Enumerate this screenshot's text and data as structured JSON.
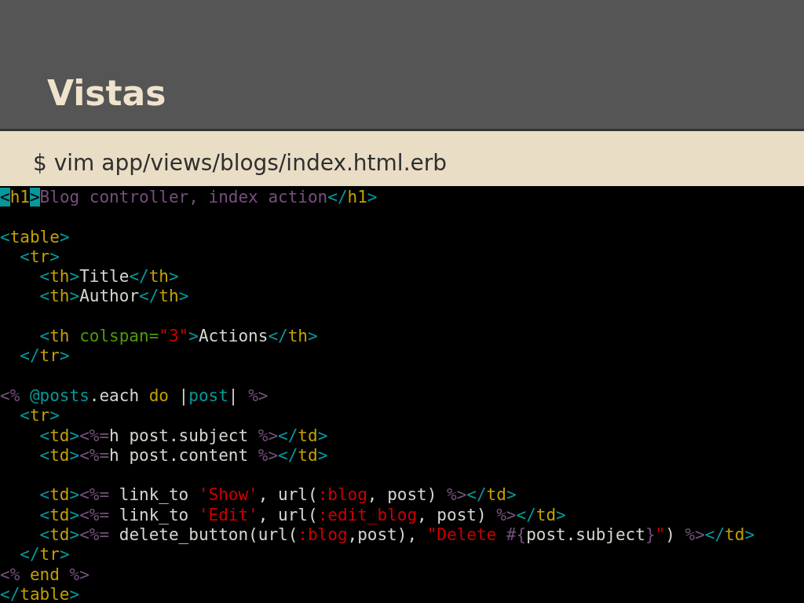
{
  "slide": {
    "title": "Vistas",
    "command": "$ vim app/views/blogs/index.html.erb"
  },
  "editor": {
    "lines": [
      {
        "kind": "code",
        "tokens": [
          {
            "t": "<",
            "color": "#06989a",
            "highlighted": true
          },
          {
            "t": "h1",
            "color": "#c4a000",
            "highlighted": false
          },
          {
            "t": ">",
            "color": "#06989a",
            "highlighted": true
          },
          {
            "t": "Blog controller, index action",
            "color": "#75507b",
            "highlighted": false
          },
          {
            "t": "</",
            "color": "#06989a",
            "highlighted": false
          },
          {
            "t": "h1",
            "color": "#c4a000",
            "highlighted": false
          },
          {
            "t": ">",
            "color": "#06989a",
            "highlighted": false
          }
        ]
      },
      {
        "kind": "blank"
      },
      {
        "kind": "code",
        "tokens": [
          {
            "t": "<",
            "color": "#06989a"
          },
          {
            "t": "table",
            "color": "#c4a000"
          },
          {
            "t": ">",
            "color": "#06989a"
          }
        ]
      },
      {
        "kind": "code",
        "tokens": [
          {
            "t": "  <",
            "color": "#06989a"
          },
          {
            "t": "tr",
            "color": "#c4a000"
          },
          {
            "t": ">",
            "color": "#06989a"
          }
        ]
      },
      {
        "kind": "code",
        "tokens": [
          {
            "t": "    <",
            "color": "#06989a"
          },
          {
            "t": "th",
            "color": "#c4a000"
          },
          {
            "t": ">",
            "color": "#06989a"
          },
          {
            "t": "Title",
            "color": "#d3d7cf"
          },
          {
            "t": "</",
            "color": "#06989a"
          },
          {
            "t": "th",
            "color": "#c4a000"
          },
          {
            "t": ">",
            "color": "#06989a"
          }
        ]
      },
      {
        "kind": "code",
        "tokens": [
          {
            "t": "    <",
            "color": "#06989a"
          },
          {
            "t": "th",
            "color": "#c4a000"
          },
          {
            "t": ">",
            "color": "#06989a"
          },
          {
            "t": "Author",
            "color": "#d3d7cf"
          },
          {
            "t": "</",
            "color": "#06989a"
          },
          {
            "t": "th",
            "color": "#c4a000"
          },
          {
            "t": ">",
            "color": "#06989a"
          }
        ]
      },
      {
        "kind": "blank"
      },
      {
        "kind": "code",
        "tokens": [
          {
            "t": "    <",
            "color": "#06989a"
          },
          {
            "t": "th",
            "color": "#c4a000"
          },
          {
            "t": " colspan=",
            "color": "#4e9a06"
          },
          {
            "t": "\"3\"",
            "color": "#cc0000"
          },
          {
            "t": ">",
            "color": "#06989a"
          },
          {
            "t": "Actions",
            "color": "#d3d7cf"
          },
          {
            "t": "</",
            "color": "#06989a"
          },
          {
            "t": "th",
            "color": "#c4a000"
          },
          {
            "t": ">",
            "color": "#06989a"
          }
        ]
      },
      {
        "kind": "code",
        "tokens": [
          {
            "t": "  </",
            "color": "#06989a"
          },
          {
            "t": "tr",
            "color": "#c4a000"
          },
          {
            "t": ">",
            "color": "#06989a"
          }
        ]
      },
      {
        "kind": "blank"
      },
      {
        "kind": "code",
        "tokens": [
          {
            "t": "<%",
            "color": "#75507b"
          },
          {
            "t": " @posts",
            "color": "#06989a"
          },
          {
            "t": ".each ",
            "color": "#d3d7cf"
          },
          {
            "t": "do",
            "color": "#c4a000"
          },
          {
            "t": " |",
            "color": "#d3d7cf"
          },
          {
            "t": "post",
            "color": "#06989a"
          },
          {
            "t": "| ",
            "color": "#d3d7cf"
          },
          {
            "t": "%>",
            "color": "#75507b"
          }
        ]
      },
      {
        "kind": "code",
        "tokens": [
          {
            "t": "  <",
            "color": "#06989a"
          },
          {
            "t": "tr",
            "color": "#c4a000"
          },
          {
            "t": ">",
            "color": "#06989a"
          }
        ]
      },
      {
        "kind": "code",
        "tokens": [
          {
            "t": "    <",
            "color": "#06989a"
          },
          {
            "t": "td",
            "color": "#c4a000"
          },
          {
            "t": ">",
            "color": "#06989a"
          },
          {
            "t": "<%=",
            "color": "#75507b"
          },
          {
            "t": "h post.subject ",
            "color": "#d3d7cf"
          },
          {
            "t": "%>",
            "color": "#75507b"
          },
          {
            "t": "</",
            "color": "#06989a"
          },
          {
            "t": "td",
            "color": "#c4a000"
          },
          {
            "t": ">",
            "color": "#06989a"
          }
        ]
      },
      {
        "kind": "code",
        "tokens": [
          {
            "t": "    <",
            "color": "#06989a"
          },
          {
            "t": "td",
            "color": "#c4a000"
          },
          {
            "t": ">",
            "color": "#06989a"
          },
          {
            "t": "<%=",
            "color": "#75507b"
          },
          {
            "t": "h post.content ",
            "color": "#d3d7cf"
          },
          {
            "t": "%>",
            "color": "#75507b"
          },
          {
            "t": "</",
            "color": "#06989a"
          },
          {
            "t": "td",
            "color": "#c4a000"
          },
          {
            "t": ">",
            "color": "#06989a"
          }
        ]
      },
      {
        "kind": "blank"
      },
      {
        "kind": "code",
        "tokens": [
          {
            "t": "    <",
            "color": "#06989a"
          },
          {
            "t": "td",
            "color": "#c4a000"
          },
          {
            "t": ">",
            "color": "#06989a"
          },
          {
            "t": "<%=",
            "color": "#75507b"
          },
          {
            "t": " link_to ",
            "color": "#d3d7cf"
          },
          {
            "t": "'Show'",
            "color": "#cc0000"
          },
          {
            "t": ", url(",
            "color": "#d3d7cf"
          },
          {
            "t": ":blog",
            "color": "#cc0000"
          },
          {
            "t": ", post) ",
            "color": "#d3d7cf"
          },
          {
            "t": "%>",
            "color": "#75507b"
          },
          {
            "t": "</",
            "color": "#06989a"
          },
          {
            "t": "td",
            "color": "#c4a000"
          },
          {
            "t": ">",
            "color": "#06989a"
          }
        ]
      },
      {
        "kind": "code",
        "tokens": [
          {
            "t": "    <",
            "color": "#06989a"
          },
          {
            "t": "td",
            "color": "#c4a000"
          },
          {
            "t": ">",
            "color": "#06989a"
          },
          {
            "t": "<%=",
            "color": "#75507b"
          },
          {
            "t": " link_to ",
            "color": "#d3d7cf"
          },
          {
            "t": "'Edit'",
            "color": "#cc0000"
          },
          {
            "t": ", url(",
            "color": "#d3d7cf"
          },
          {
            "t": ":edit_blog",
            "color": "#cc0000"
          },
          {
            "t": ", post) ",
            "color": "#d3d7cf"
          },
          {
            "t": "%>",
            "color": "#75507b"
          },
          {
            "t": "</",
            "color": "#06989a"
          },
          {
            "t": "td",
            "color": "#c4a000"
          },
          {
            "t": ">",
            "color": "#06989a"
          }
        ]
      },
      {
        "kind": "code",
        "tokens": [
          {
            "t": "    <",
            "color": "#06989a"
          },
          {
            "t": "td",
            "color": "#c4a000"
          },
          {
            "t": ">",
            "color": "#06989a"
          },
          {
            "t": "<%=",
            "color": "#75507b"
          },
          {
            "t": " delete_button(url(",
            "color": "#d3d7cf"
          },
          {
            "t": ":blog",
            "color": "#cc0000"
          },
          {
            "t": ",post), ",
            "color": "#d3d7cf"
          },
          {
            "t": "\"Delete ",
            "color": "#cc0000"
          },
          {
            "t": "#{",
            "color": "#75507b"
          },
          {
            "t": "post.subject",
            "color": "#d3d7cf"
          },
          {
            "t": "}",
            "color": "#75507b"
          },
          {
            "t": "\"",
            "color": "#cc0000"
          },
          {
            "t": ") ",
            "color": "#d3d7cf"
          },
          {
            "t": "%>",
            "color": "#75507b"
          },
          {
            "t": "</",
            "color": "#06989a"
          },
          {
            "t": "td",
            "color": "#c4a000"
          },
          {
            "t": ">",
            "color": "#06989a"
          }
        ]
      },
      {
        "kind": "code",
        "tokens": [
          {
            "t": "  </",
            "color": "#06989a"
          },
          {
            "t": "tr",
            "color": "#c4a000"
          },
          {
            "t": ">",
            "color": "#06989a"
          }
        ]
      },
      {
        "kind": "code",
        "tokens": [
          {
            "t": "<%",
            "color": "#75507b"
          },
          {
            "t": " end ",
            "color": "#c4a000"
          },
          {
            "t": "%>",
            "color": "#75507b"
          }
        ]
      },
      {
        "kind": "code",
        "tokens": [
          {
            "t": "</",
            "color": "#06989a"
          },
          {
            "t": "table",
            "color": "#c4a000"
          },
          {
            "t": ">",
            "color": "#06989a"
          }
        ]
      }
    ]
  }
}
